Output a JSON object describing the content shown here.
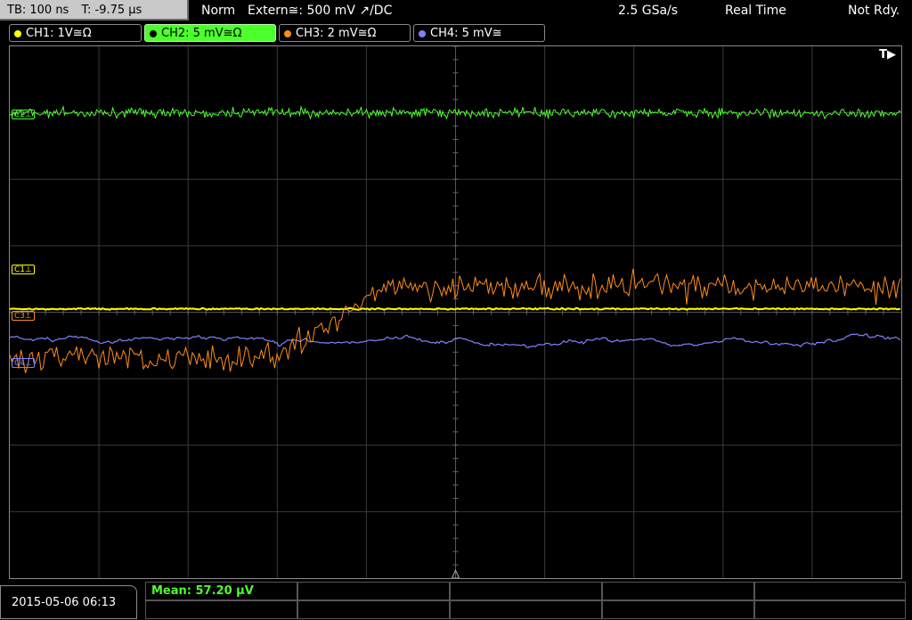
{
  "topbar": {
    "timebase": "TB: 100 ns",
    "trigger_time": "T: -9.75 µs",
    "mode": "Norm",
    "trigger_source": "Extern≅: 500 mV ↗/DC",
    "sample_rate": "2.5 GSa/s",
    "acq_mode": "Real Time",
    "status": "Not Rdy."
  },
  "channels": [
    {
      "label": "CH1: 1V≅Ω",
      "color": "#ffff00"
    },
    {
      "label": "CH2: 5 mV≅Ω",
      "color": "#4cff2b"
    },
    {
      "label": "CH3: 2 mV≅Ω",
      "color": "#ff8c1a"
    },
    {
      "label": "CH4: 5 mV≅",
      "color": "#8080ff"
    }
  ],
  "markers": {
    "c1": "C1⊥",
    "c2": "C2⊥",
    "c3": "C3⊥",
    "c4": "C4⊥",
    "trigger_indicator": "T▶"
  },
  "waveforms": {
    "ch1": {
      "level_div": 3.95,
      "noise_div": 0.02
    },
    "ch2": {
      "level_div": 1.0,
      "noise_div": 0.12
    },
    "ch3": {
      "step_time_div": 3.0,
      "pre_level_div": 4.7,
      "post_level_div": 3.6,
      "noise_div": 0.35
    },
    "ch4": {
      "pre_level_div": 4.4,
      "post_level_div": 4.45,
      "noise_div": 0.06
    }
  },
  "grid": {
    "h_divs": 10,
    "v_divs": 8
  },
  "bottom": {
    "datetime": "2015-05-06 06:13",
    "measurement": "Mean: 57.20 µV"
  }
}
